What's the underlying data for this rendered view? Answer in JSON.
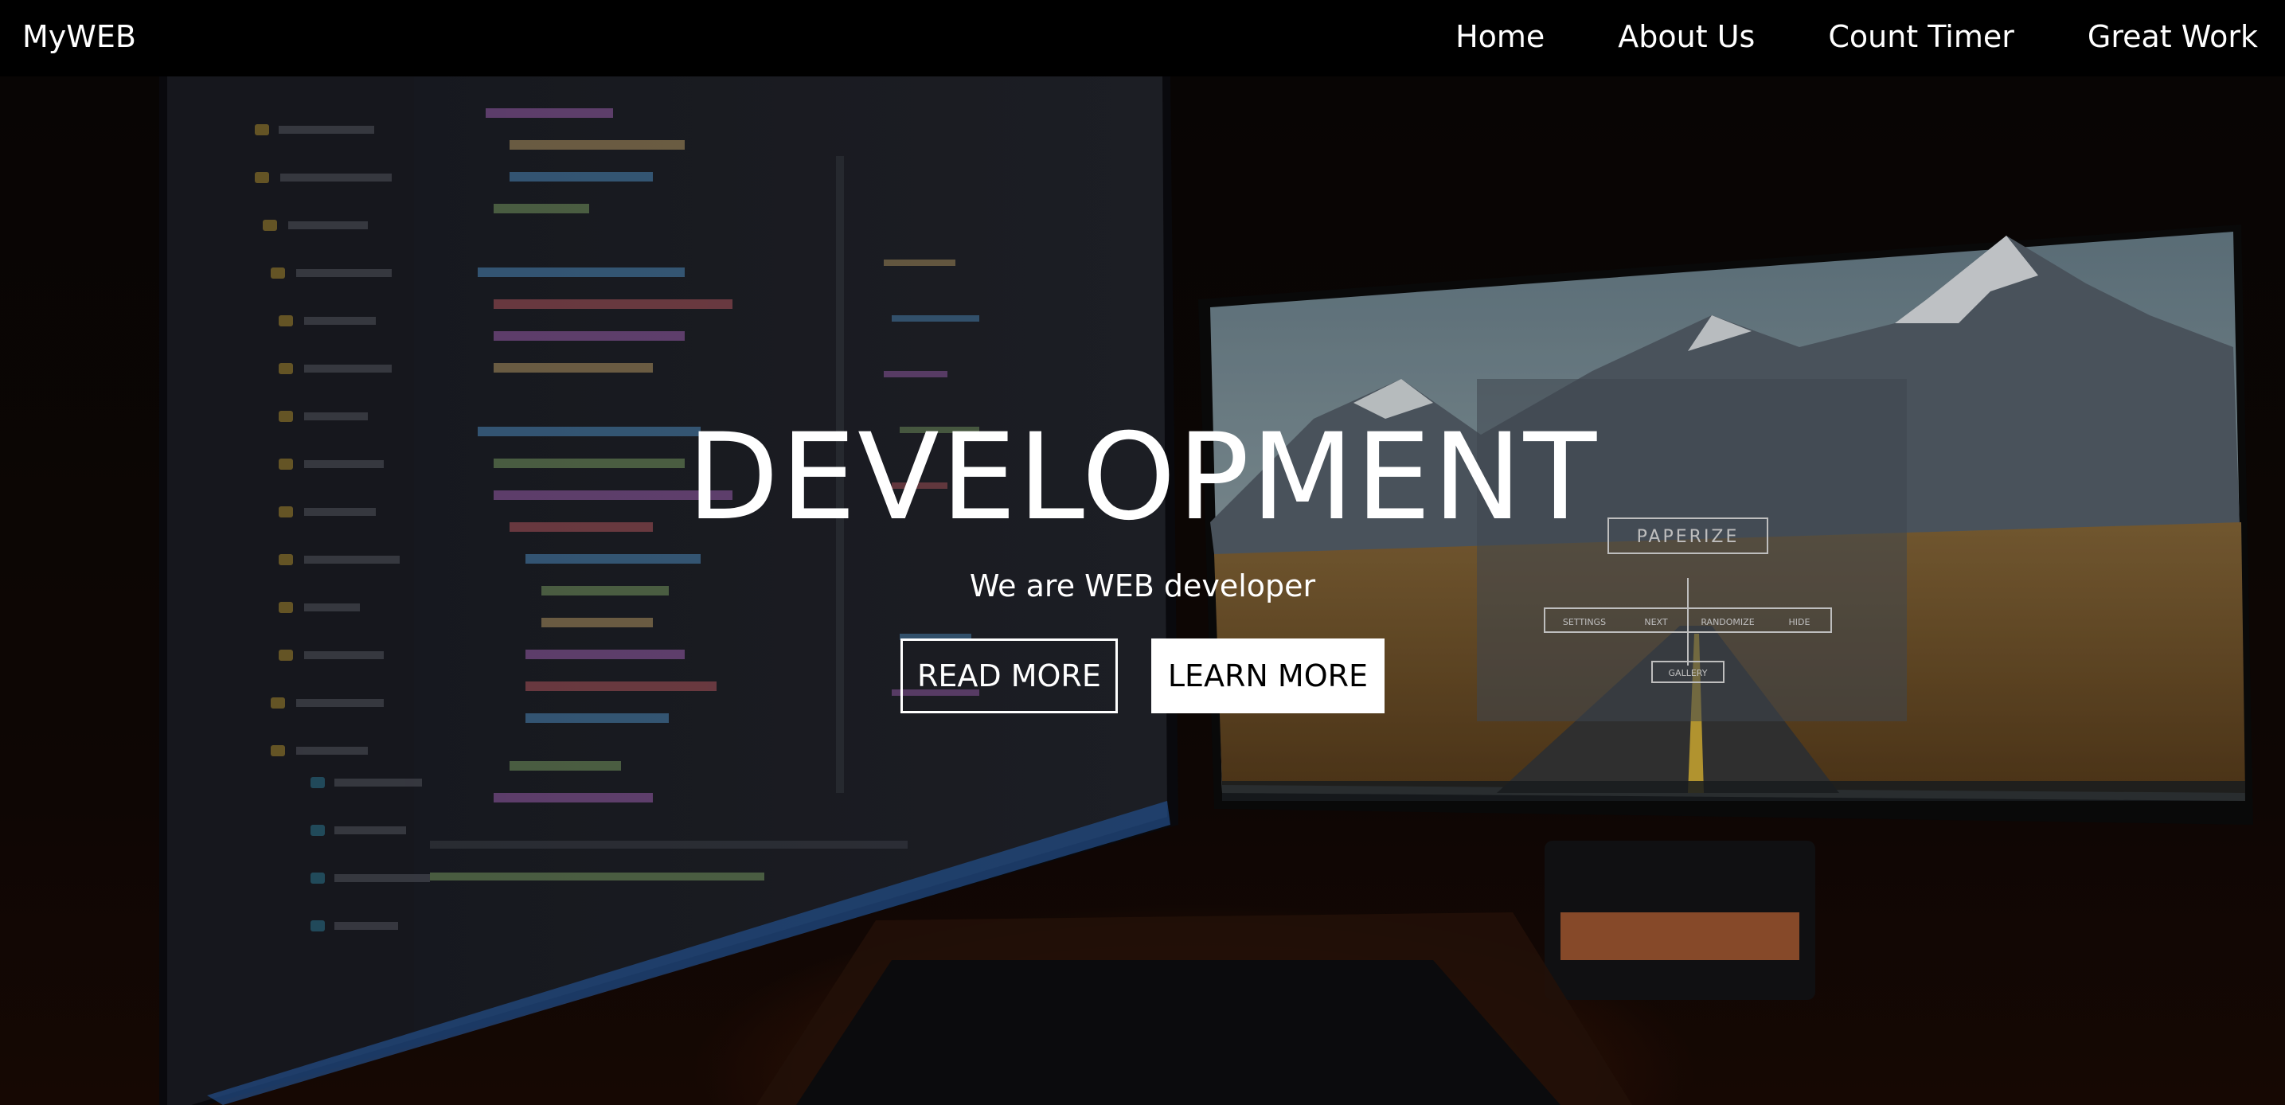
{
  "nav": {
    "brand": "MyWEB",
    "links": [
      "Home",
      "About Us",
      "Count Timer",
      "Great Work"
    ]
  },
  "hero": {
    "title": "DEVELOPMENT",
    "subtitle": "We are WEB developer",
    "buttons": {
      "read_more": "READ MORE",
      "learn_more": "LEARN MORE"
    },
    "background_image": "dual-monitor desk setup showing code editor and mountain road wallpaper"
  },
  "screen_app": {
    "title": "PAPERIZE",
    "menu": [
      "SETTINGS",
      "NEXT",
      "RANDOMIZE",
      "HIDE"
    ],
    "gallery_button": "GALLERY"
  },
  "colors": {
    "nav_background": "#000000",
    "text": "#ffffff",
    "solid_button_bg": "#ffffff",
    "solid_button_text": "#000000"
  }
}
